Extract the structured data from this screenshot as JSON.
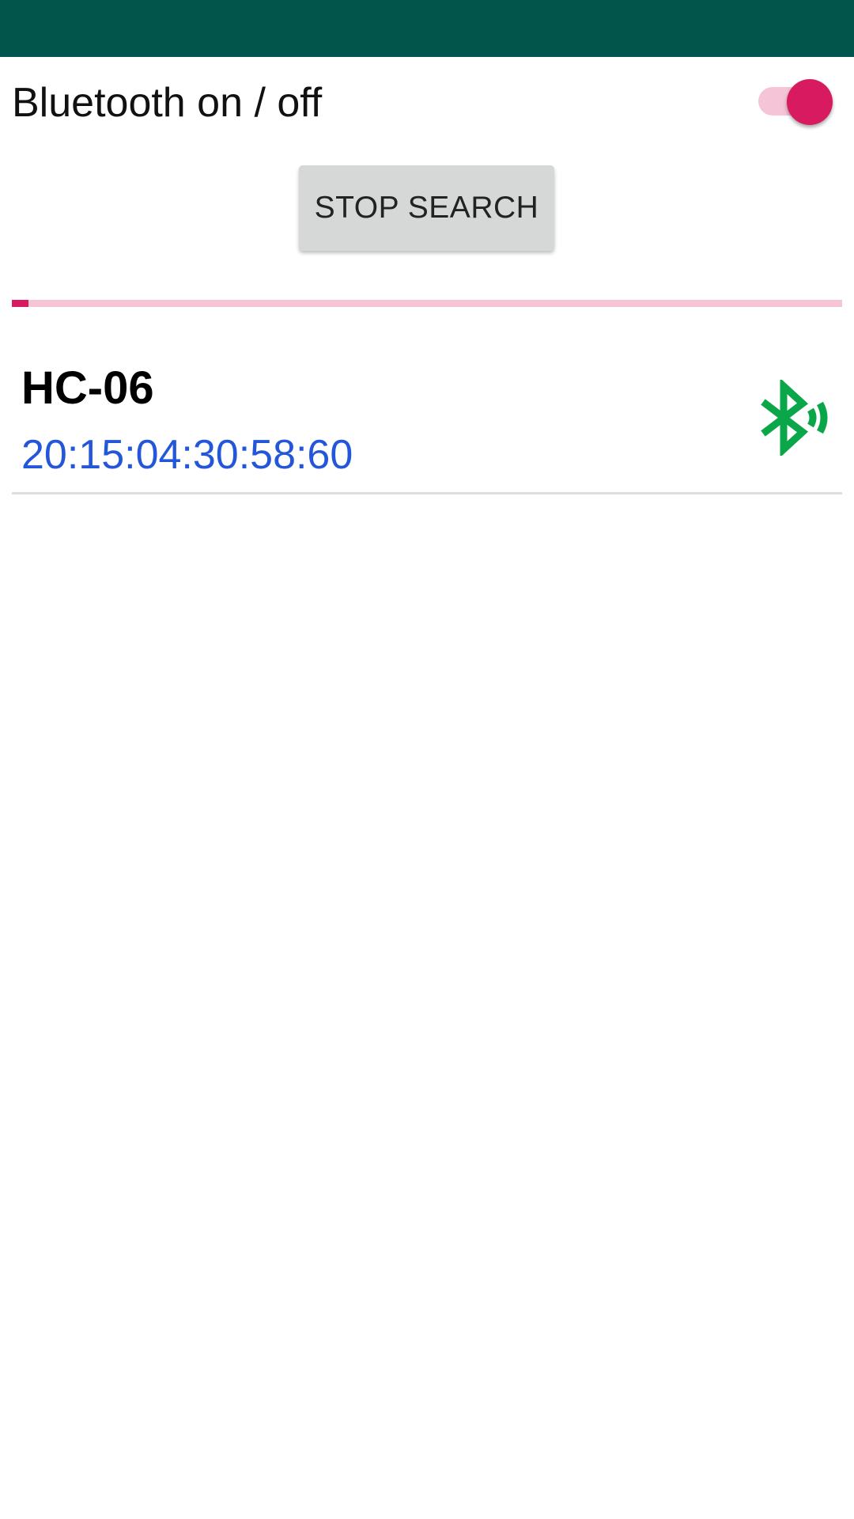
{
  "colors": {
    "status_bar": "#02554B",
    "accent": "#D81B60",
    "accent_light": "#F5C4D6",
    "button_bg": "#D6D7D7",
    "address_text": "#2356D8",
    "bluetooth_icon": "#0AA64A"
  },
  "bluetooth_toggle": {
    "label": "Bluetooth on / off",
    "state": "on"
  },
  "search_button": {
    "label": "STOP SEARCH"
  },
  "search_progress": {
    "value_percent": 2
  },
  "devices": [
    {
      "name": "HC-06",
      "address": "20:15:04:30:58:60",
      "icon": "bluetooth-searching-icon"
    }
  ]
}
